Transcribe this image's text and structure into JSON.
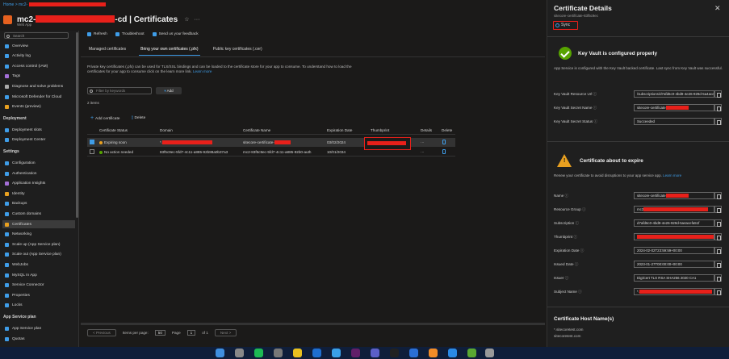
{
  "breadcrumb": "Home > mc2-",
  "header": {
    "title_prefix": "mc2-",
    "title_suffix": "-cd | Certificates",
    "subtitle": "Web App"
  },
  "sidebar": {
    "search_placeholder": "Search",
    "items": [
      {
        "label": "Overview",
        "icon": "globe-icon",
        "color": "#3f9de8"
      },
      {
        "label": "Activity log",
        "icon": "log-icon",
        "color": "#3f9de8"
      },
      {
        "label": "Access control (IAM)",
        "icon": "people-icon",
        "color": "#3f9de8"
      },
      {
        "label": "Tags",
        "icon": "tag-icon",
        "color": "#a46fd8"
      },
      {
        "label": "Diagnose and solve problems",
        "icon": "wrench-icon",
        "color": "#aaaaaa"
      },
      {
        "label": "Microsoft Defender for Cloud",
        "icon": "shield-icon",
        "color": "#3f9de8"
      },
      {
        "label": "Events (preview)",
        "icon": "bolt-icon",
        "color": "#e8a020"
      }
    ],
    "section_deployment": "Deployment",
    "deployment_items": [
      {
        "label": "Deployment slots",
        "icon": "slots-icon",
        "color": "#3f9de8"
      },
      {
        "label": "Deployment Center",
        "icon": "cube-icon",
        "color": "#3f9de8"
      }
    ],
    "section_settings": "Settings",
    "settings_items": [
      {
        "label": "Configuration",
        "icon": "bars-icon",
        "color": "#3f9de8"
      },
      {
        "label": "Authentication",
        "icon": "key-icon",
        "color": "#3f9de8"
      },
      {
        "label": "Application Insights",
        "icon": "bulb-icon",
        "color": "#a46fd8"
      },
      {
        "label": "Identity",
        "icon": "id-icon",
        "color": "#e8a020"
      },
      {
        "label": "Backups",
        "icon": "backup-icon",
        "color": "#3f9de8"
      },
      {
        "label": "Custom domains",
        "icon": "domain-icon",
        "color": "#3f9de8"
      },
      {
        "label": "Certificates",
        "icon": "certificate-icon",
        "color": "#e8a020",
        "selected": true
      },
      {
        "label": "Networking",
        "icon": "network-icon",
        "color": "#3f9de8"
      },
      {
        "label": "Scale up (App Service plan)",
        "icon": "scale-up-icon",
        "color": "#3f9de8"
      },
      {
        "label": "Scale out (App Service plan)",
        "icon": "scale-out-icon",
        "color": "#3f9de8"
      },
      {
        "label": "WebJobs",
        "icon": "webjobs-icon",
        "color": "#3f9de8"
      },
      {
        "label": "MySQL In App",
        "icon": "database-icon",
        "color": "#3f9de8"
      },
      {
        "label": "Service Connector",
        "icon": "connector-icon",
        "color": "#3f9de8"
      },
      {
        "label": "Properties",
        "icon": "properties-icon",
        "color": "#3f9de8"
      },
      {
        "label": "Locks",
        "icon": "lock-icon",
        "color": "#3f9de8"
      }
    ],
    "section_plan": "App Service plan",
    "plan_items": [
      {
        "label": "App Service plan",
        "icon": "plan-icon",
        "color": "#3f9de8"
      },
      {
        "label": "Quotas",
        "icon": "quota-icon",
        "color": "#3f9de8"
      }
    ]
  },
  "toolbar": {
    "refresh": "Refresh",
    "troubleshoot": "Troubleshoot",
    "feedback": "Send us your feedback"
  },
  "tabs": [
    "Managed certificates",
    "Bring your own certificates (.pfx)",
    "Public key certificates (.cer)"
  ],
  "description": "Private key certificates (.pfx) can be used for TLS/SSL bindings and can be loaded to the certificate store for your app to consume. To understand how to load the certificates for your app to consume click on the learn more link.",
  "learn_more": "Learn more",
  "filter_placeholder": "Filter by keywords",
  "add_filter": "Add",
  "item_count": "2 items",
  "actions": {
    "add": "Add certificate",
    "delete": "Delete"
  },
  "table": {
    "columns": [
      "Certificate Status",
      "Domain",
      "Certificate Name",
      "Expiration Date",
      "Thumbprint",
      "Details",
      "Delete"
    ],
    "rows": [
      {
        "status": "Expiring soon",
        "domain": "*.",
        "name": "sitecore-certificate-",
        "expiration": "03/02/2024",
        "details": "···"
      },
      {
        "status": "No action needed",
        "domain": "83f5c9ec-5fd7-4c11-a885-92b88a0b37a3",
        "name": "mc2-83f5c9ec-5fd7-4c11-a885-92b0-auth",
        "expiration": "10/01/2034",
        "details": "···"
      }
    ]
  },
  "pager": {
    "previous": "< Previous",
    "items_label": "Items per page:",
    "page_size": "50",
    "page_label": "Page",
    "page": "1",
    "of": "of 1",
    "next": "Next >"
  },
  "panel": {
    "title": "Certificate Details",
    "subtitle": "sitecore-certificate-83f5c9ec",
    "sync": "Sync",
    "kv_title": "Key Vault is configured properly",
    "kv_text": "App Service is configured with the Key Vault backed certificate. Last sync from Key Vault was successful.",
    "kv_fields": [
      {
        "label": "Key Vault Resource Url",
        "value": "/subscriptions/d7afd6c0-4bd9-4e26-929d-5a4acefa51f"
      },
      {
        "label": "Key Vault Secret Name",
        "value": "sitecore-certificate"
      },
      {
        "label": "Key Vault Secret Status",
        "value": "Succeeded"
      }
    ],
    "warn_title": "Certificate about to expire",
    "warn_text": "Renew your certificate to avoid disruptions to your app service app.",
    "warn_link": "Learn more",
    "cert_fields": [
      {
        "label": "Name",
        "value": "sitecore-certificate"
      },
      {
        "label": "Resource Group",
        "value": "mc2"
      },
      {
        "label": "Subscription",
        "value": "d7afd6c0-4bd9-4e26-929d-5a4acefa51f"
      },
      {
        "label": "Thumbprint",
        "value": ""
      },
      {
        "label": "Expiration Date",
        "value": "2024-02-02T23:59:59+00:00"
      },
      {
        "label": "Issued Date",
        "value": "2023-01-27T00:00:00+00:00"
      },
      {
        "label": "Issuer",
        "value": "DigiCert TLS RSA SHA256 2020 CA1"
      },
      {
        "label": "Subject Name",
        "value": "*."
      }
    ],
    "host_title": "Certificate Host Name(s)",
    "hosts": [
      "*.sitecoretest.com",
      "sitecoretest.com"
    ]
  },
  "taskbar": {
    "apps": [
      {
        "icon": "finder-icon",
        "color": "#3f8fe0"
      },
      {
        "icon": "launchpad-icon",
        "color": "#888888"
      },
      {
        "icon": "spotify-icon",
        "color": "#1db954"
      },
      {
        "icon": "settings-icon",
        "color": "#777777"
      },
      {
        "icon": "chrome-icon",
        "color": "#e8c020"
      },
      {
        "icon": "outlook-icon",
        "color": "#1f6fd0"
      },
      {
        "icon": "files-icon",
        "color": "#3aa0e8"
      },
      {
        "icon": "slack-icon",
        "color": "#611f69"
      },
      {
        "icon": "teams-icon",
        "color": "#5b5fc7"
      },
      {
        "icon": "terminal-icon",
        "color": "#222222"
      },
      {
        "icon": "vpn-icon",
        "color": "#2a6fd6"
      },
      {
        "icon": "sublime-icon",
        "color": "#f28c28"
      },
      {
        "icon": "vscode-icon",
        "color": "#2b8ae6"
      },
      {
        "icon": "git-icon",
        "color": "#5aa832"
      },
      {
        "icon": "trash-icon",
        "color": "#999999"
      }
    ]
  }
}
